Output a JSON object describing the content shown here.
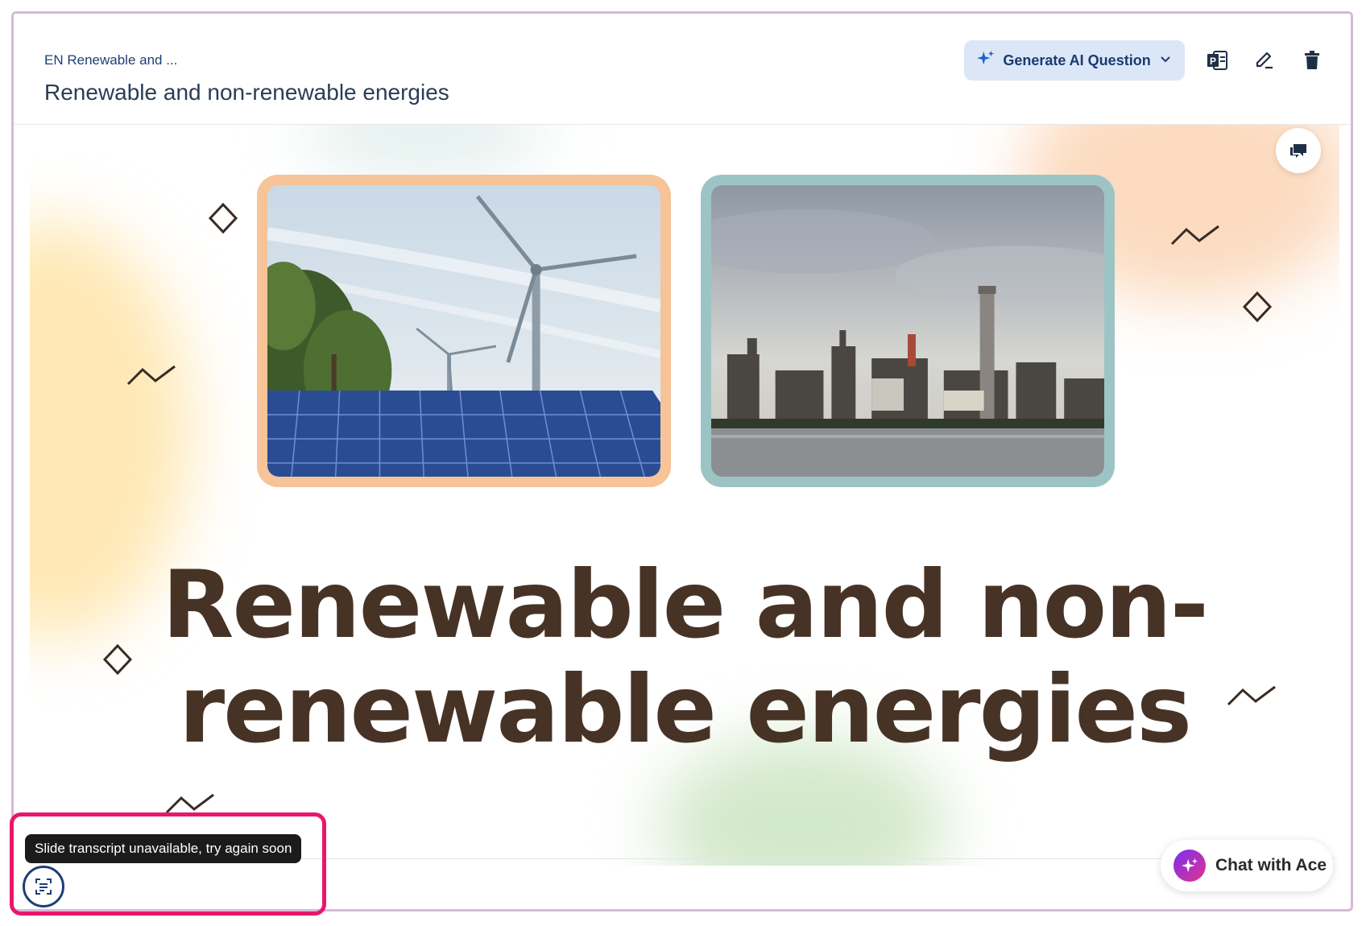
{
  "header": {
    "breadcrumb": "EN Renewable and ...",
    "title": "Renewable and non-renewable energies",
    "generate_button": "Generate AI Question",
    "icons": [
      "sparkle-icon",
      "chevron-down-icon",
      "powerpoint-icon",
      "edit-icon",
      "trash-icon"
    ]
  },
  "slide": {
    "title": "Renewable and non-renewable energies",
    "images": [
      {
        "name": "wind-solar-image",
        "border_color": "#f7c398"
      },
      {
        "name": "industrial-plant-image",
        "border_color": "#9dc4c4"
      }
    ]
  },
  "chat": {
    "label": "Chat with Ace"
  },
  "transcript": {
    "tooltip": "Slide transcript unavailable, try again soon"
  },
  "colors": {
    "accent": "#1d3f78",
    "title_brown": "#473326",
    "highlight": "#e8176c"
  }
}
